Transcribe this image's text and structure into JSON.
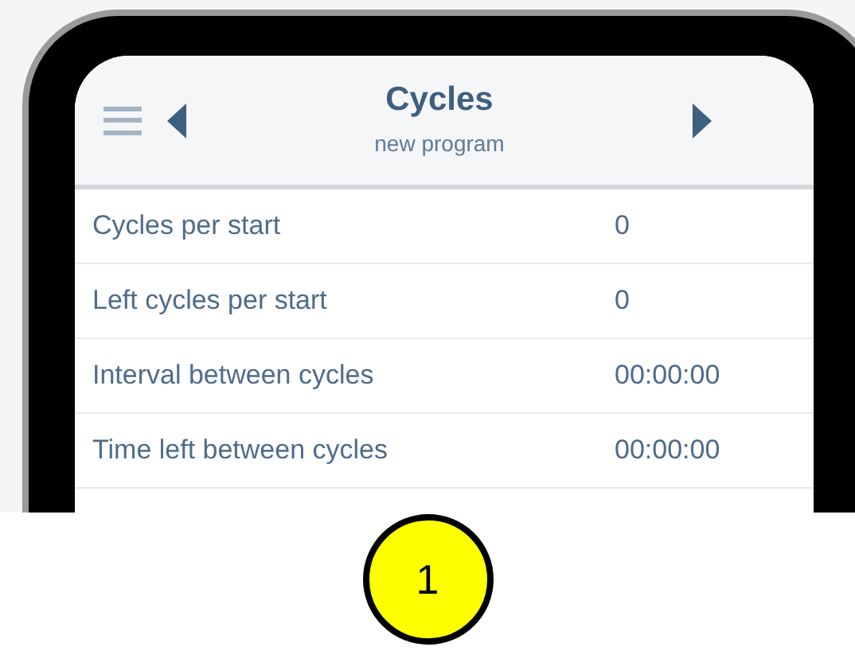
{
  "header": {
    "title": "Cycles",
    "subtitle": "new program"
  },
  "rows": [
    {
      "label": "Cycles per start",
      "value": "0"
    },
    {
      "label": "Left cycles per start",
      "value": "0"
    },
    {
      "label": "Interval between cycles",
      "value": "00:00:00"
    },
    {
      "label": "Time left between cycles",
      "value": "00:00:00"
    }
  ],
  "callout": {
    "number": "1"
  }
}
